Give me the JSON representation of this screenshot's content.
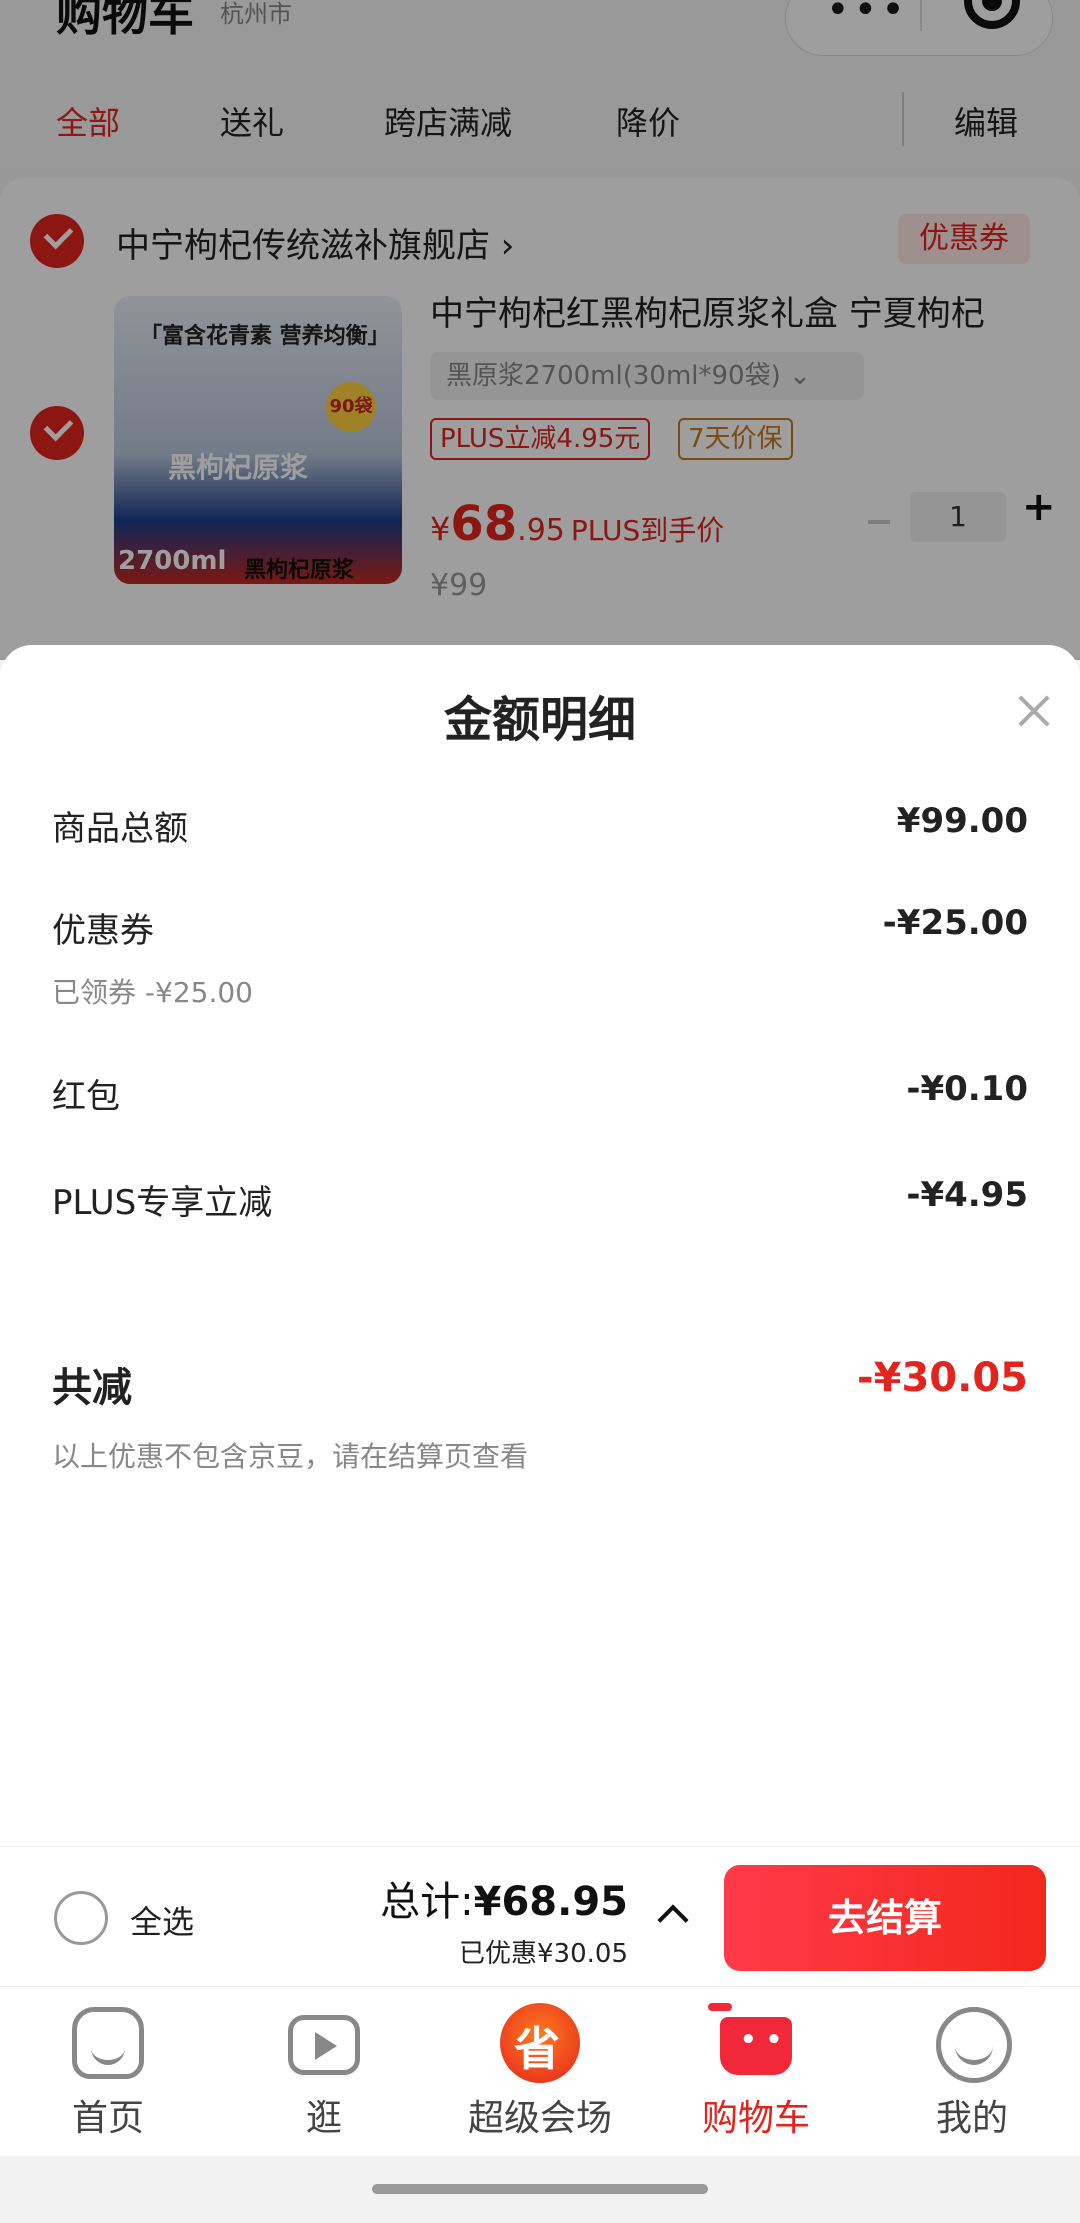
{
  "header": {
    "title": "购物车",
    "location": "杭州市"
  },
  "tabs": [
    {
      "label": "全部",
      "active": true
    },
    {
      "label": "送礼",
      "active": false
    },
    {
      "label": "跨店满减",
      "active": false
    },
    {
      "label": "降价",
      "active": false
    }
  ],
  "edit_label": "编辑",
  "store": {
    "name": "中宁枸杞传统滋补旗舰店",
    "coupon_tag": "优惠券"
  },
  "product": {
    "image_text_top": "「富含花青素  营养均衡」",
    "image_text_name": "黑枸杞原浆",
    "image_text_size": "2700ml",
    "image_text_bottom": "黑枸杞原浆",
    "image_badge": "90袋",
    "title": "中宁枸杞红黑枸杞原浆礼盒 宁夏枸杞",
    "variant": "黑原浆2700ml(30ml*90袋)",
    "tag_plus": "PLUS立减4.95元",
    "tag_guarantee": "7天价保",
    "price_currency": "¥",
    "price_int": "68",
    "price_dec": ".95",
    "price_label": "PLUS到手价",
    "original_price": "¥99",
    "quantity": "1"
  },
  "sheet": {
    "title": "金额明细",
    "rows": [
      {
        "label": "商品总额",
        "value": "¥99.00"
      },
      {
        "label": "优惠券",
        "value": "-¥25.00",
        "sub": "已领券 -¥25.00"
      },
      {
        "label": "红包",
        "value": "-¥0.10"
      },
      {
        "label": "PLUS专享立减",
        "value": "-¥4.95"
      }
    ],
    "total_label": "共减",
    "total_value": "-¥30.05",
    "note": "以上优惠不包含京豆，请在结算页查看"
  },
  "bottom_bar": {
    "select_all": "全选",
    "total_prefix": "总计:",
    "total_value": "¥68.95",
    "discount": "已优惠¥30.05",
    "checkout": "去结算"
  },
  "tabbar": [
    {
      "label": "首页",
      "icon": "home-icon",
      "active": false
    },
    {
      "label": "逛",
      "icon": "video-icon",
      "active": false
    },
    {
      "label": "超级会场",
      "icon": "super-venue-icon",
      "active": false
    },
    {
      "label": "购物车",
      "icon": "cart-icon",
      "active": true
    },
    {
      "label": "我的",
      "icon": "profile-icon",
      "active": false
    }
  ],
  "colors": {
    "accent": "#e3241c",
    "dim_overlay": "rgba(0,0,0,0.38)"
  }
}
